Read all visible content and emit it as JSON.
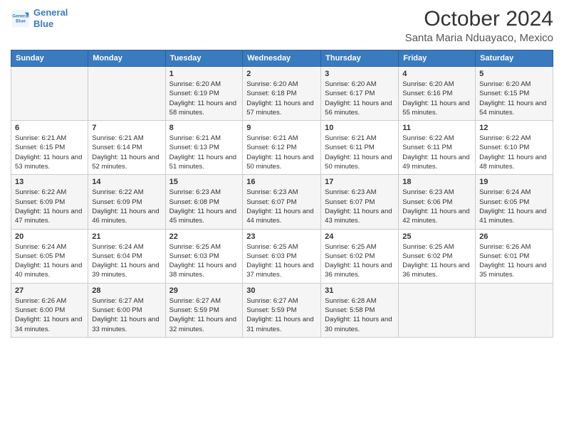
{
  "logo": {
    "line1": "General",
    "line2": "Blue"
  },
  "title": "October 2024",
  "location": "Santa Maria Nduayaco, Mexico",
  "weekdays": [
    "Sunday",
    "Monday",
    "Tuesday",
    "Wednesday",
    "Thursday",
    "Friday",
    "Saturday"
  ],
  "weeks": [
    [
      {
        "day": "",
        "content": ""
      },
      {
        "day": "",
        "content": ""
      },
      {
        "day": "1",
        "content": "Sunrise: 6:20 AM\nSunset: 6:19 PM\nDaylight: 11 hours and 58 minutes."
      },
      {
        "day": "2",
        "content": "Sunrise: 6:20 AM\nSunset: 6:18 PM\nDaylight: 11 hours and 57 minutes."
      },
      {
        "day": "3",
        "content": "Sunrise: 6:20 AM\nSunset: 6:17 PM\nDaylight: 11 hours and 56 minutes."
      },
      {
        "day": "4",
        "content": "Sunrise: 6:20 AM\nSunset: 6:16 PM\nDaylight: 11 hours and 55 minutes."
      },
      {
        "day": "5",
        "content": "Sunrise: 6:20 AM\nSunset: 6:15 PM\nDaylight: 11 hours and 54 minutes."
      }
    ],
    [
      {
        "day": "6",
        "content": "Sunrise: 6:21 AM\nSunset: 6:15 PM\nDaylight: 11 hours and 53 minutes."
      },
      {
        "day": "7",
        "content": "Sunrise: 6:21 AM\nSunset: 6:14 PM\nDaylight: 11 hours and 52 minutes."
      },
      {
        "day": "8",
        "content": "Sunrise: 6:21 AM\nSunset: 6:13 PM\nDaylight: 11 hours and 51 minutes."
      },
      {
        "day": "9",
        "content": "Sunrise: 6:21 AM\nSunset: 6:12 PM\nDaylight: 11 hours and 50 minutes."
      },
      {
        "day": "10",
        "content": "Sunrise: 6:21 AM\nSunset: 6:11 PM\nDaylight: 11 hours and 50 minutes."
      },
      {
        "day": "11",
        "content": "Sunrise: 6:22 AM\nSunset: 6:11 PM\nDaylight: 11 hours and 49 minutes."
      },
      {
        "day": "12",
        "content": "Sunrise: 6:22 AM\nSunset: 6:10 PM\nDaylight: 11 hours and 48 minutes."
      }
    ],
    [
      {
        "day": "13",
        "content": "Sunrise: 6:22 AM\nSunset: 6:09 PM\nDaylight: 11 hours and 47 minutes."
      },
      {
        "day": "14",
        "content": "Sunrise: 6:22 AM\nSunset: 6:09 PM\nDaylight: 11 hours and 46 minutes."
      },
      {
        "day": "15",
        "content": "Sunrise: 6:23 AM\nSunset: 6:08 PM\nDaylight: 11 hours and 45 minutes."
      },
      {
        "day": "16",
        "content": "Sunrise: 6:23 AM\nSunset: 6:07 PM\nDaylight: 11 hours and 44 minutes."
      },
      {
        "day": "17",
        "content": "Sunrise: 6:23 AM\nSunset: 6:07 PM\nDaylight: 11 hours and 43 minutes."
      },
      {
        "day": "18",
        "content": "Sunrise: 6:23 AM\nSunset: 6:06 PM\nDaylight: 11 hours and 42 minutes."
      },
      {
        "day": "19",
        "content": "Sunrise: 6:24 AM\nSunset: 6:05 PM\nDaylight: 11 hours and 41 minutes."
      }
    ],
    [
      {
        "day": "20",
        "content": "Sunrise: 6:24 AM\nSunset: 6:05 PM\nDaylight: 11 hours and 40 minutes."
      },
      {
        "day": "21",
        "content": "Sunrise: 6:24 AM\nSunset: 6:04 PM\nDaylight: 11 hours and 39 minutes."
      },
      {
        "day": "22",
        "content": "Sunrise: 6:25 AM\nSunset: 6:03 PM\nDaylight: 11 hours and 38 minutes."
      },
      {
        "day": "23",
        "content": "Sunrise: 6:25 AM\nSunset: 6:03 PM\nDaylight: 11 hours and 37 minutes."
      },
      {
        "day": "24",
        "content": "Sunrise: 6:25 AM\nSunset: 6:02 PM\nDaylight: 11 hours and 36 minutes."
      },
      {
        "day": "25",
        "content": "Sunrise: 6:25 AM\nSunset: 6:02 PM\nDaylight: 11 hours and 36 minutes."
      },
      {
        "day": "26",
        "content": "Sunrise: 6:26 AM\nSunset: 6:01 PM\nDaylight: 11 hours and 35 minutes."
      }
    ],
    [
      {
        "day": "27",
        "content": "Sunrise: 6:26 AM\nSunset: 6:00 PM\nDaylight: 11 hours and 34 minutes."
      },
      {
        "day": "28",
        "content": "Sunrise: 6:27 AM\nSunset: 6:00 PM\nDaylight: 11 hours and 33 minutes."
      },
      {
        "day": "29",
        "content": "Sunrise: 6:27 AM\nSunset: 5:59 PM\nDaylight: 11 hours and 32 minutes."
      },
      {
        "day": "30",
        "content": "Sunrise: 6:27 AM\nSunset: 5:59 PM\nDaylight: 11 hours and 31 minutes."
      },
      {
        "day": "31",
        "content": "Sunrise: 6:28 AM\nSunset: 5:58 PM\nDaylight: 11 hours and 30 minutes."
      },
      {
        "day": "",
        "content": ""
      },
      {
        "day": "",
        "content": ""
      }
    ]
  ]
}
